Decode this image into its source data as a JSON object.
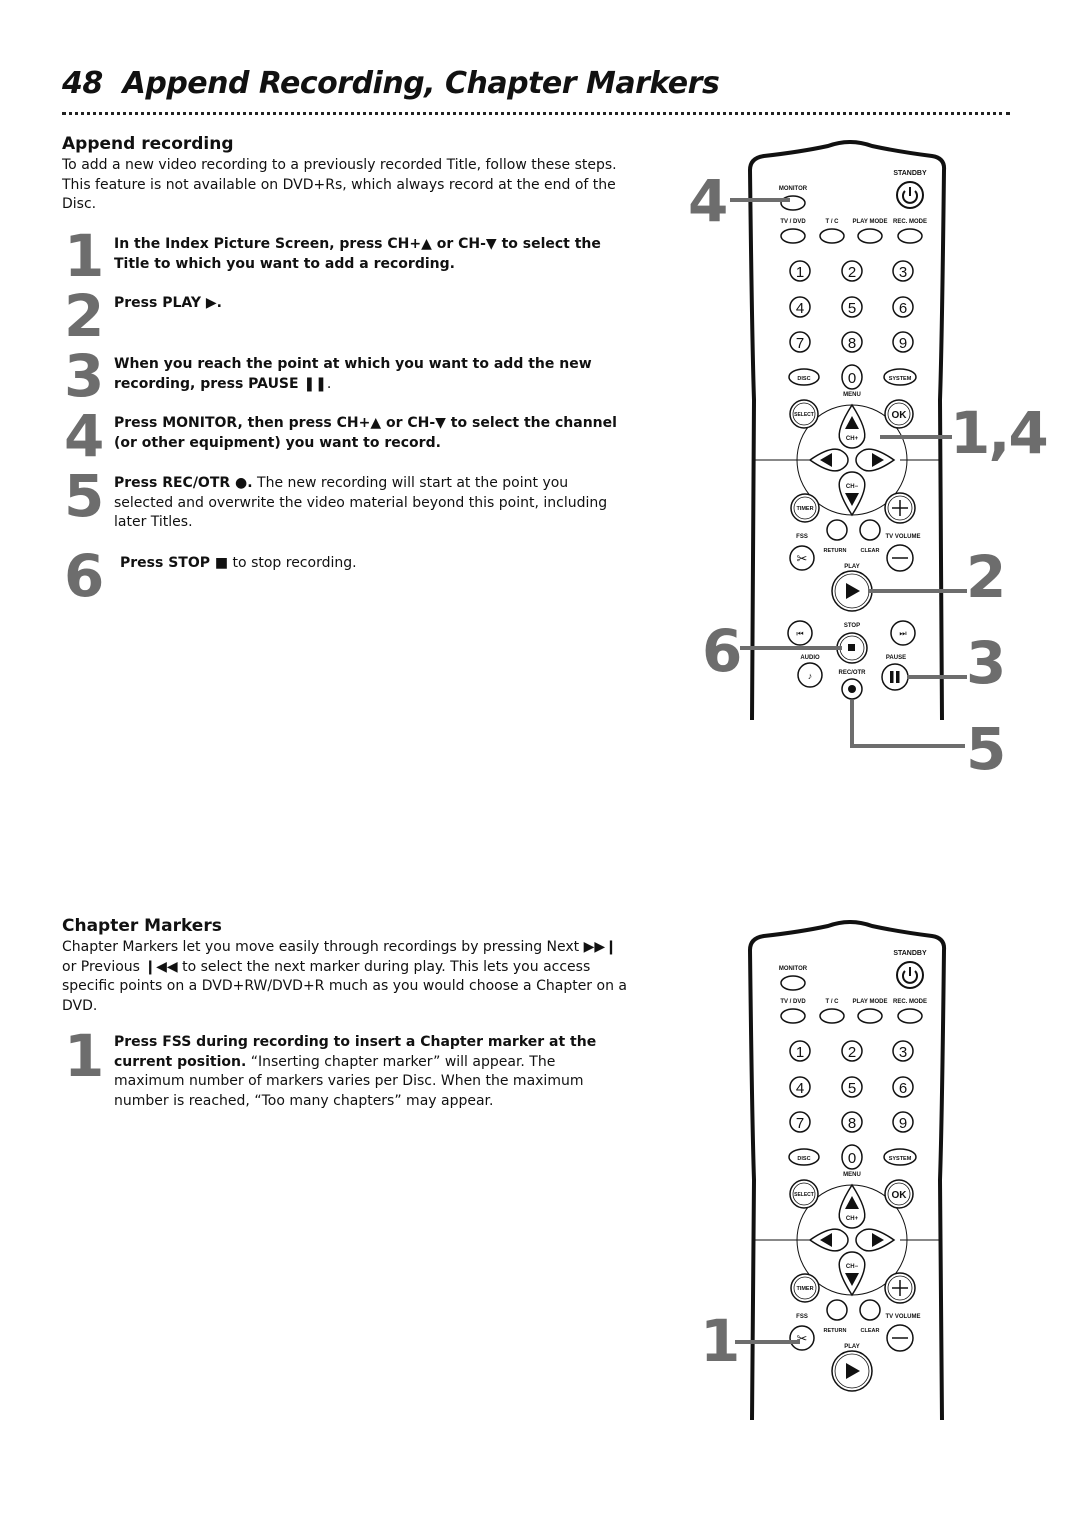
{
  "page": {
    "number": "48",
    "title": "Append Recording, Chapter Markers"
  },
  "append": {
    "heading": "Append recording",
    "intro": "To add a new video recording to a previously recorded Title, follow these steps. This feature is not available on DVD+Rs, which always record at the end of the Disc.",
    "steps": [
      {
        "num": "1",
        "bold": "In the Index Picture Screen, press CH+▲ or CH-▼ to select the Title to which you want to add a recording.",
        "rest": ""
      },
      {
        "num": "2",
        "bold": "Press PLAY ▶.",
        "rest": ""
      },
      {
        "num": "3",
        "bold": "When you reach the point at which you want to add the new recording, press PAUSE ❚❚",
        "rest": "."
      },
      {
        "num": "4",
        "bold": "Press MONITOR, then press CH+▲ or CH-▼ to select the channel (or other equipment) you want to record.",
        "rest": ""
      },
      {
        "num": "5",
        "bold": "Press REC/OTR ●.",
        "rest": " The new recording will start at the point you selected and overwrite the video material beyond this point, including later Titles."
      },
      {
        "num": "6",
        "bold": "Press STOP ■",
        "rest": " to stop recording."
      }
    ]
  },
  "chapter": {
    "heading": "Chapter Markers",
    "intro": "Chapter Markers let you move easily through recordings by pressing Next ▶▶❙ or Previous ❙◀◀ to select the next marker during play. This lets you access specific points on a DVD+RW/DVD+R much as you would choose a Chapter on a DVD.",
    "steps": [
      {
        "num": "1",
        "bold": "Press FSS during recording to insert a Chapter marker at the current position.",
        "rest": " “Inserting chapter marker” will appear. The maximum number of markers varies per Disc. When the maximum number is reached, “Too many chapters” may appear."
      }
    ]
  },
  "remote": {
    "labels": {
      "standby": "STANDBY",
      "monitor": "MONITOR",
      "tv_dvd": "TV / DVD",
      "tc": "T / C",
      "play_mode": "PLAY MODE",
      "rec_mode": "REC. MODE",
      "digits": [
        "1",
        "2",
        "3",
        "4",
        "5",
        "6",
        "7",
        "8",
        "9"
      ],
      "disc": "DISC",
      "zero": "0",
      "system": "SYSTEM",
      "menu": "MENU",
      "select": "SELECT",
      "ok": "OK",
      "ch_plus": "CH+",
      "ch_minus": "CH−",
      "timer": "TIMER",
      "fss": "FSS",
      "return": "RETURN",
      "clear": "CLEAR",
      "tv_volume": "TV VOLUME",
      "play": "PLAY",
      "stop": "STOP",
      "audio": "AUDIO",
      "rec_otr": "REC/OTR",
      "pause": "PAUSE"
    },
    "callouts_top": {
      "monitor": "4",
      "ch": "1,4",
      "play": "2",
      "stop": "6",
      "pause": "3",
      "rec": "5"
    },
    "callouts_bottom": {
      "fss": "1"
    }
  }
}
